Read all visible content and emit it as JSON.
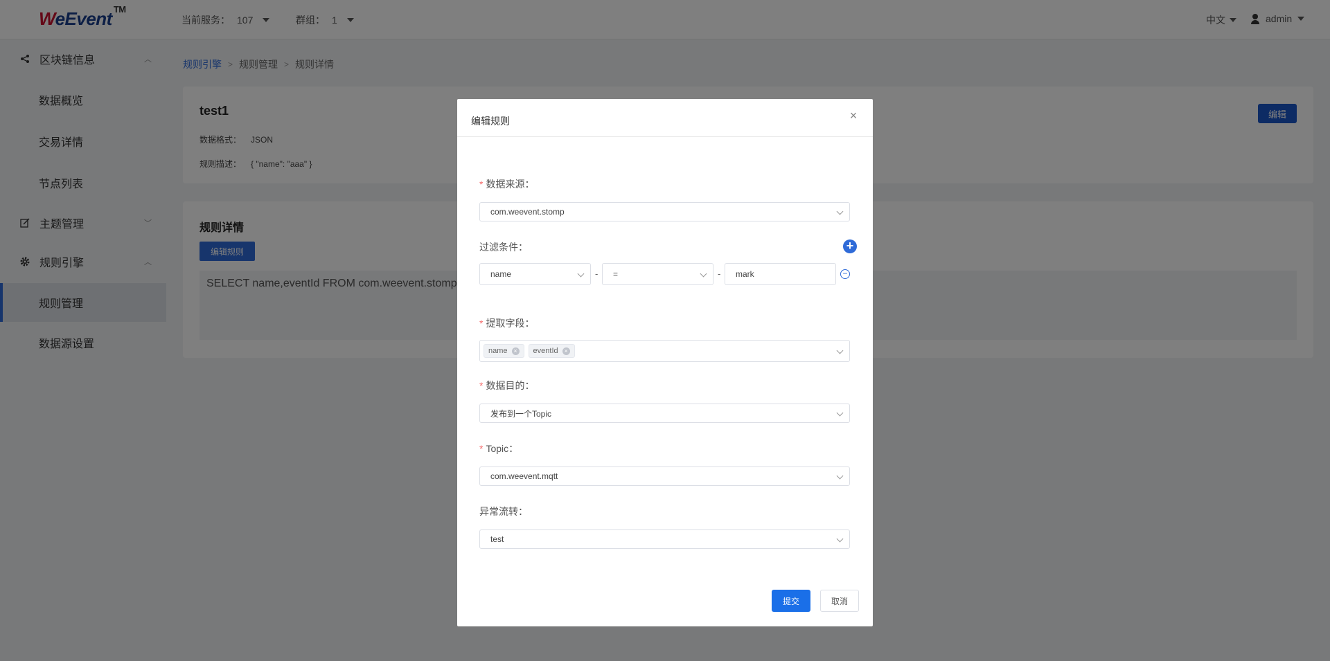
{
  "header": {
    "logo_w": "W",
    "logo_rest": "eEvent",
    "logo_tm": "TM",
    "service_label": "当前服务：",
    "service_value": "107",
    "group_label": "群组：",
    "group_value": "1",
    "language": "中文",
    "user": "admin"
  },
  "sidebar": {
    "group_blockchain": "区块链信息",
    "items_blockchain": [
      "数据概览",
      "交易详情",
      "节点列表"
    ],
    "group_topic": "主题管理",
    "group_rule": "规则引擎",
    "items_rule": [
      "规则管理",
      "数据源设置"
    ]
  },
  "breadcrumb": [
    "规则引擎",
    "规则管理",
    "规则详情"
  ],
  "rule_card": {
    "name": "test1",
    "format_label": "数据格式：",
    "format_value": "JSON",
    "desc_label": "规则描述：",
    "desc_value": "{ \"name\": \"aaa\" }",
    "edit_label": "编辑"
  },
  "detail_card": {
    "title": "规则详情",
    "edit_rule_label": "编辑规则",
    "sql": "SELECT name,eventId FROM com.weevent.stomp"
  },
  "modal": {
    "title": "编辑规则",
    "close": "×",
    "source_label": "数据来源：",
    "source_value": "com.weevent.stomp",
    "filter_label": "过滤条件：",
    "filter_field": "name",
    "filter_op": "=",
    "filter_value": "mark",
    "fields_label": "提取字段：",
    "fields_tags": [
      "name",
      "eventId"
    ],
    "target_label": "数据目的：",
    "target_value": "发布到一个Topic",
    "topic_label": "Topic：",
    "topic_value": "com.weevent.mqtt",
    "error_label": "异常流转：",
    "error_value": "test",
    "submit": "提交",
    "cancel": "取消"
  }
}
